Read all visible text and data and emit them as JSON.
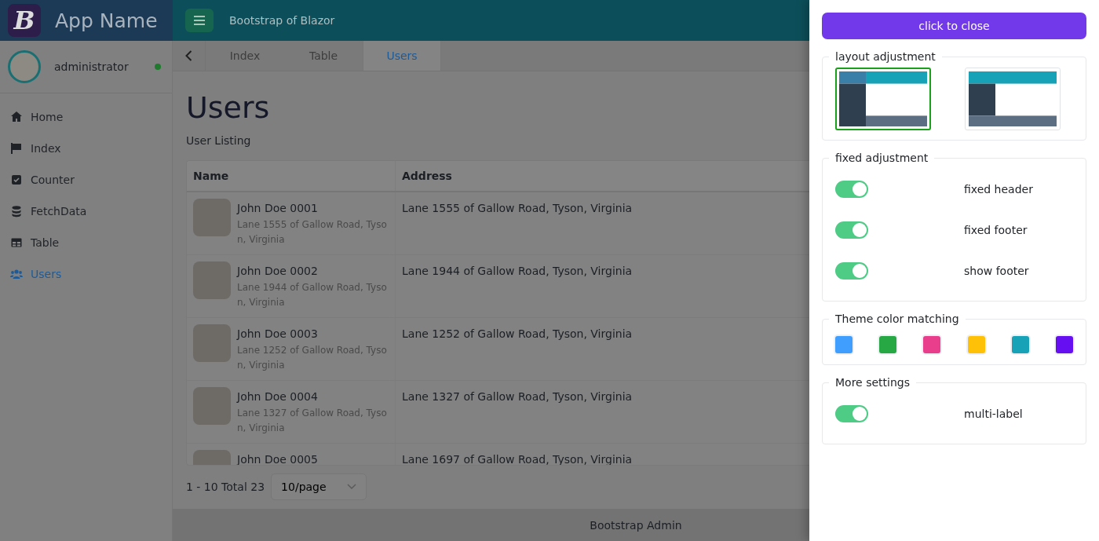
{
  "header": {
    "app_name": "App Name",
    "logo_letter": "B",
    "title": "Bootstrap of Blazor"
  },
  "user": {
    "name": "administrator",
    "online": true
  },
  "nav": [
    {
      "label": "Home",
      "selected": false
    },
    {
      "label": "Index",
      "selected": false
    },
    {
      "label": "Counter",
      "selected": false
    },
    {
      "label": "FetchData",
      "selected": false
    },
    {
      "label": "Table",
      "selected": false
    },
    {
      "label": "Users",
      "selected": true
    }
  ],
  "tabs": [
    {
      "label": "Index",
      "selected": false
    },
    {
      "label": "Table",
      "selected": false
    },
    {
      "label": "Users",
      "selected": true
    }
  ],
  "page": {
    "title": "Users",
    "subtitle": "User Listing"
  },
  "table": {
    "columns": [
      "Name",
      "Address"
    ],
    "rows": [
      {
        "name": "John Doe 0001",
        "detail": "Lane 1555 of Gallow Road, Tyson, Virginia",
        "address": "Lane 1555 of Gallow Road, Tyson, Virginia"
      },
      {
        "name": "John Doe 0002",
        "detail": "Lane 1944 of Gallow Road, Tyson, Virginia",
        "address": "Lane 1944 of Gallow Road, Tyson, Virginia"
      },
      {
        "name": "John Doe 0003",
        "detail": "Lane 1252 of Gallow Road, Tyson, Virginia",
        "address": "Lane 1252 of Gallow Road, Tyson, Virginia"
      },
      {
        "name": "John Doe 0004",
        "detail": "Lane 1327 of Gallow Road, Tyson, Virginia",
        "address": "Lane 1327 of Gallow Road, Tyson, Virginia"
      },
      {
        "name": "John Doe 0005",
        "address": "Lane 1697 of Gallow Road, Tyson, Virginia"
      }
    ]
  },
  "pagination": {
    "summary": "1 - 10 Total 23",
    "page_size": "10/page"
  },
  "footer": "Bootstrap Admin",
  "drawer": {
    "close_button": "click to close",
    "sections": [
      {
        "kind": "layout",
        "title": "layout adjustment",
        "options": [
          {
            "selected": true
          },
          {
            "selected": false
          }
        ]
      },
      {
        "kind": "toggles",
        "title": "fixed adjustment",
        "toggles": [
          {
            "label": "fixed header",
            "on": true
          },
          {
            "label": "fixed footer",
            "on": true
          },
          {
            "label": "show footer",
            "on": true
          }
        ]
      },
      {
        "kind": "colors",
        "title": "Theme color matching",
        "colors": [
          {
            "color": "#409eff"
          },
          {
            "color": "#28a745"
          },
          {
            "color": "#e83e8c"
          },
          {
            "color": "#ffc107"
          },
          {
            "color": "#17a2b8"
          },
          {
            "color": "#6610f2"
          }
        ]
      },
      {
        "kind": "toggles",
        "title": "More settings",
        "toggles": [
          {
            "label": "multi-label",
            "on": true
          }
        ]
      }
    ]
  }
}
